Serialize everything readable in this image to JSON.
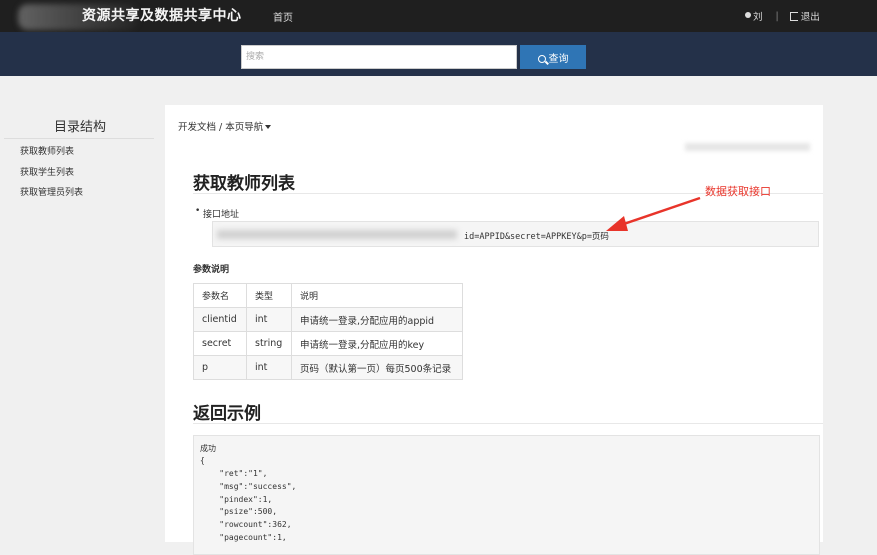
{
  "navbar": {
    "brand": "资源共享及数据共享中心",
    "home": "首页",
    "user": "刘",
    "logout": "退出"
  },
  "search": {
    "placeholder": "搜索",
    "button": "查询"
  },
  "sidebar": {
    "title": "目录结构",
    "items": [
      "获取教师列表",
      "获取学生列表",
      "获取管理员列表"
    ]
  },
  "main": {
    "breadcrumb": "开发文档 / 本页导航",
    "heading": "获取教师列表",
    "endpoint_label": "接口地址",
    "endpoint_url": "id=APPID&secret=APPKEY&p=页码",
    "params_title": "参数说明",
    "table": {
      "headers": [
        "参数名",
        "类型",
        "说明"
      ],
      "rows": [
        [
          "clientid",
          "int",
          "申请统一登录,分配应用的appid"
        ],
        [
          "secret",
          "string",
          "申请统一登录,分配应用的key"
        ],
        [
          "p",
          "int",
          "页码（默认第一页）每页500条记录"
        ]
      ]
    },
    "example_heading": "返回示例",
    "code_lines": [
      "成功",
      "{",
      "    \"ret\":\"1\",",
      "    \"msg\":\"success\",",
      "    \"pindex\":1,",
      "    \"psize\":500,",
      "    \"rowcount\":362,",
      "    \"pagecount\":1,"
    ]
  },
  "annotation": {
    "label": "数据获取接口",
    "color": "#e8342a"
  }
}
